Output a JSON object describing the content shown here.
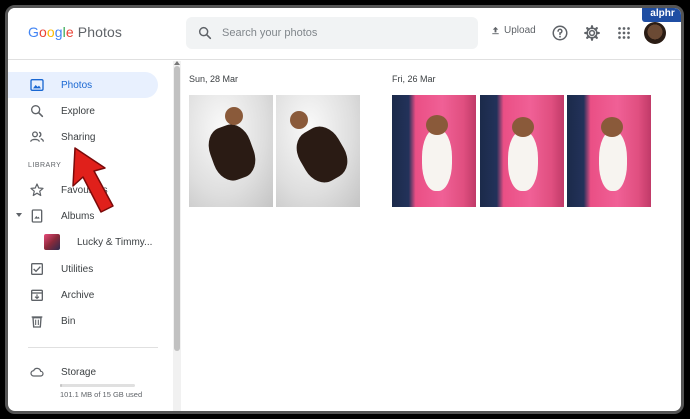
{
  "app": {
    "logo_letters": [
      "G",
      "o",
      "o",
      "g",
      "l",
      "e"
    ],
    "logo_product": "Photos",
    "badge": "alphr"
  },
  "header": {
    "search_placeholder": "Search your photos",
    "upload_label": "Upload",
    "icons": [
      "help-icon",
      "settings-icon",
      "apps-grid-icon"
    ]
  },
  "sidebar": {
    "items": [
      {
        "label": "Photos",
        "icon": "photos-icon",
        "active": true
      },
      {
        "label": "Explore",
        "icon": "search-icon"
      },
      {
        "label": "Sharing",
        "icon": "people-icon"
      }
    ],
    "library_heading": "LIBRARY",
    "library_items": [
      {
        "label": "Favourites",
        "icon": "star-icon"
      },
      {
        "label": "Albums",
        "icon": "album-icon"
      },
      {
        "label": "Lucky & Timmy...",
        "icon": "album-thumbnail"
      },
      {
        "label": "Utilities",
        "icon": "utilities-icon"
      },
      {
        "label": "Archive",
        "icon": "archive-icon"
      },
      {
        "label": "Bin",
        "icon": "bin-icon"
      }
    ],
    "storage": {
      "label": "Storage",
      "usage_text": "101.1 MB of 15 GB used",
      "used_fraction": 0.007
    }
  },
  "photo_groups": [
    {
      "date": "Sun, 28 Mar",
      "count": 2,
      "style": "white"
    },
    {
      "date": "Fri, 26 Mar",
      "count": 3,
      "style": "pink"
    }
  ],
  "colors": {
    "accent": "#1967d2",
    "active_bg": "#e8f0fe",
    "annotation_arrow": "#e0201b"
  }
}
